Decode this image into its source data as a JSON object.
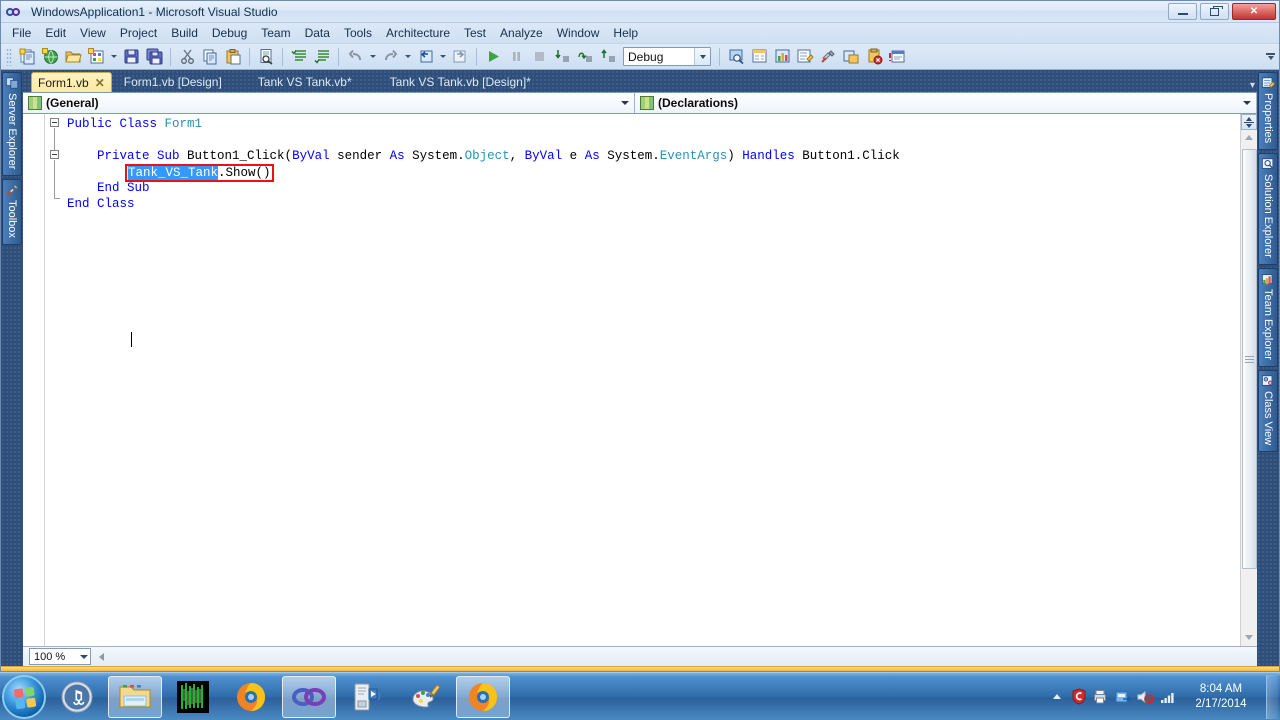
{
  "window": {
    "title": "WindowsApplication1 - Microsoft Visual Studio",
    "logo_icon": "visual-studio-infinity-icon",
    "controls": {
      "minimize": "minimize-icon",
      "maximize": "restore-icon",
      "close": "close-icon"
    }
  },
  "menubar": {
    "items": [
      {
        "label": "File"
      },
      {
        "label": "Edit"
      },
      {
        "label": "View"
      },
      {
        "label": "Project"
      },
      {
        "label": "Build"
      },
      {
        "label": "Debug"
      },
      {
        "label": "Team"
      },
      {
        "label": "Data"
      },
      {
        "label": "Tools"
      },
      {
        "label": "Architecture"
      },
      {
        "label": "Test"
      },
      {
        "label": "Analyze"
      },
      {
        "label": "Window"
      },
      {
        "label": "Help"
      }
    ]
  },
  "toolbar": {
    "config_value": "Debug",
    "groups": [
      {
        "icons": [
          "new-project-icon",
          "new-web-site-icon",
          "open-file-icon",
          "add-new-item-icon",
          "dropdown-arrow",
          "save-icon",
          "save-all-icon"
        ]
      },
      {
        "icons": [
          "cut-icon",
          "copy-icon",
          "paste-icon"
        ]
      },
      {
        "icons": [
          "find-in-files-icon"
        ]
      },
      {
        "icons": [
          "comment-lines-icon",
          "uncomment-lines-icon"
        ]
      },
      {
        "icons": [
          "undo-icon",
          "undo-dropdown-arrow",
          "redo-icon",
          "redo-dropdown-arrow",
          "navigate-backward-icon",
          "navigate-dropdown-arrow",
          "navigate-forward-icon"
        ]
      },
      {
        "icons": [
          "start-debugging-icon",
          "pause-icon",
          "stop-icon",
          "step-into-icon",
          "step-over-icon",
          "step-out-icon"
        ]
      },
      {
        "icons": [
          "find-symbol-icon",
          "properties-window-icon",
          "object-browser-icon",
          "solution-explorer-icon",
          "toolbox-icon",
          "error-list-icon",
          "breakpoints-icon",
          "task-list-icon"
        ]
      }
    ],
    "overflow_label": "toolbar-overflow-icon"
  },
  "left_dock": {
    "items": [
      {
        "label": "Server Explorer",
        "icon": "server-explorer-icon"
      },
      {
        "label": "Toolbox",
        "icon": "toolbox-icon"
      }
    ]
  },
  "right_dock": {
    "items": [
      {
        "label": "Properties",
        "icon": "properties-icon"
      },
      {
        "label": "Solution Explorer",
        "icon": "solution-explorer-icon"
      },
      {
        "label": "Team Explorer",
        "icon": "team-explorer-icon"
      },
      {
        "label": "Class View",
        "icon": "class-view-icon"
      }
    ]
  },
  "tabs": [
    {
      "label": "Form1.vb",
      "active": true,
      "close_icon": "close-tab-icon"
    },
    {
      "label": "Form1.vb [Design]",
      "active": false
    },
    {
      "label": "Tank VS Tank.vb*",
      "active": false
    },
    {
      "label": "Tank VS Tank.vb [Design]*",
      "active": false
    }
  ],
  "code_navigation": {
    "member_scope": "(General)",
    "member_list": "(Declarations)",
    "scope_icon": "module-icon",
    "list_icon": "module-icon"
  },
  "code": {
    "language": "VB.NET",
    "lines": [
      {
        "indent": 0,
        "outline": "collapse-box",
        "tokens": [
          {
            "t": "Public ",
            "k": "kw"
          },
          {
            "t": "Class ",
            "k": "kw"
          },
          {
            "t": "Form1",
            "k": "typ"
          }
        ]
      },
      {
        "indent": 0,
        "tokens": []
      },
      {
        "indent": 0,
        "outline": "collapse-box",
        "tokens": [
          {
            "t": "    ",
            "k": "pln"
          },
          {
            "t": "Private Sub ",
            "k": "kw"
          },
          {
            "t": "Button1_Click(",
            "k": "pln"
          },
          {
            "t": "ByVal ",
            "k": "kw"
          },
          {
            "t": "sender ",
            "k": "pln"
          },
          {
            "t": "As ",
            "k": "kw"
          },
          {
            "t": "System.",
            "k": "pln"
          },
          {
            "t": "Object",
            "k": "typ"
          },
          {
            "t": ", ",
            "k": "pln"
          },
          {
            "t": "ByVal ",
            "k": "kw"
          },
          {
            "t": "e ",
            "k": "pln"
          },
          {
            "t": "As ",
            "k": "kw"
          },
          {
            "t": "System.",
            "k": "pln"
          },
          {
            "t": "EventArgs",
            "k": "typ"
          },
          {
            "t": ") ",
            "k": "pln"
          },
          {
            "t": "Handles ",
            "k": "kw"
          },
          {
            "t": "Button1.Click",
            "k": "pln"
          }
        ]
      },
      {
        "indent": 0,
        "highlight_box": true,
        "tokens": [
          {
            "t": "        ",
            "k": "pln"
          },
          {
            "t": "Tank_VS_Tank",
            "k": "sel"
          },
          {
            "t": ".Show()",
            "k": "pln"
          }
        ]
      },
      {
        "indent": 0,
        "tokens": [
          {
            "t": "    ",
            "k": "pln"
          },
          {
            "t": "End ",
            "k": "kw"
          },
          {
            "t": "Sub",
            "k": "kw"
          }
        ]
      },
      {
        "indent": 0,
        "tokens": [
          {
            "t": "End ",
            "k": "kw"
          },
          {
            "t": "Class",
            "k": "kw"
          }
        ]
      }
    ],
    "selection_text": "Tank_VS_Tank",
    "annotation": {
      "type": "red-rectangle",
      "target_text": "Tank_VS_Tank.Show()",
      "color": "#ee1111"
    },
    "colors": {
      "keyword": "#0000ff",
      "type": "#2b91af",
      "plain": "#000000",
      "selection_bg": "#3399ff",
      "background": "#ffffff"
    }
  },
  "editor_footer": {
    "zoom_value": "100 %",
    "zoom_caret": "chevron-down-icon",
    "hscroll_left_icon": "scroll-left-arrow-icon"
  },
  "scrollbar": {
    "split_icon": "split-window-icon",
    "up_icon": "scroll-up-arrow-icon",
    "down_icon": "scroll-down-arrow-icon",
    "thumb_grip": "scrollbar-grip-icon"
  },
  "taskbar": {
    "start": {
      "icon": "windows-start-orb-icon"
    },
    "items": [
      {
        "icon": "itunes-icon",
        "state": "pinned"
      },
      {
        "icon": "windows-explorer-icon",
        "state": "pinned"
      },
      {
        "icon": "matrix-app-icon",
        "state": "pinned"
      },
      {
        "icon": "firefox-icon",
        "state": "pinned"
      },
      {
        "icon": "visual-studio-icon",
        "state": "running-active"
      },
      {
        "icon": "media-server-icon",
        "state": "pinned"
      },
      {
        "icon": "paint-icon",
        "state": "pinned"
      },
      {
        "icon": "firefox-window-icon",
        "state": "running"
      }
    ],
    "tray": {
      "overflow_icon": "show-hidden-icons-icon",
      "icons": [
        "comodo-shield-icon",
        "printer-icon",
        "safely-remove-hardware-icon",
        "volume-muted-icon",
        "network-signal-icon"
      ],
      "time": "8:04 AM",
      "date": "2/17/2014",
      "show_desktop": "show-desktop-button"
    }
  }
}
